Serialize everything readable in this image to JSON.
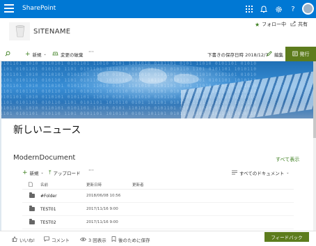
{
  "suitebar": {
    "brand": "SharePoint"
  },
  "site": {
    "name": "SITENAME",
    "follow_label": "フォロー中",
    "share_label": "共有"
  },
  "commandbar": {
    "new_label": "新規",
    "changes_label": "変更の破棄",
    "saved_text": "下書きの保存日時 2018/12/7",
    "edit_label": "編集",
    "publish_label": "発行"
  },
  "news": {
    "title": "新しいニュース"
  },
  "library": {
    "title": "ModernDocument",
    "see_all": "すべて表示",
    "new_label": "新規",
    "upload_label": "アップロード",
    "view_label": "すべてのドキュメント",
    "columns": [
      "名前",
      "更新日時",
      "更新者"
    ],
    "rows": [
      {
        "name": "#Folder",
        "date": "2018/06/08 10:56"
      },
      {
        "name": "TEST01",
        "date": "2017/11/16 9:00"
      },
      {
        "name": "TEST02",
        "date": "2017/11/16 9:00"
      }
    ]
  },
  "footer": {
    "like_label": "いいね!",
    "comment_label": "コメント",
    "views_label": "3 回表示",
    "save_label": "後のために保存",
    "feedback_label": "フィードバック"
  },
  "colors": {
    "suitebar": "#0078d4",
    "accent_green": "#5d7c1d"
  }
}
